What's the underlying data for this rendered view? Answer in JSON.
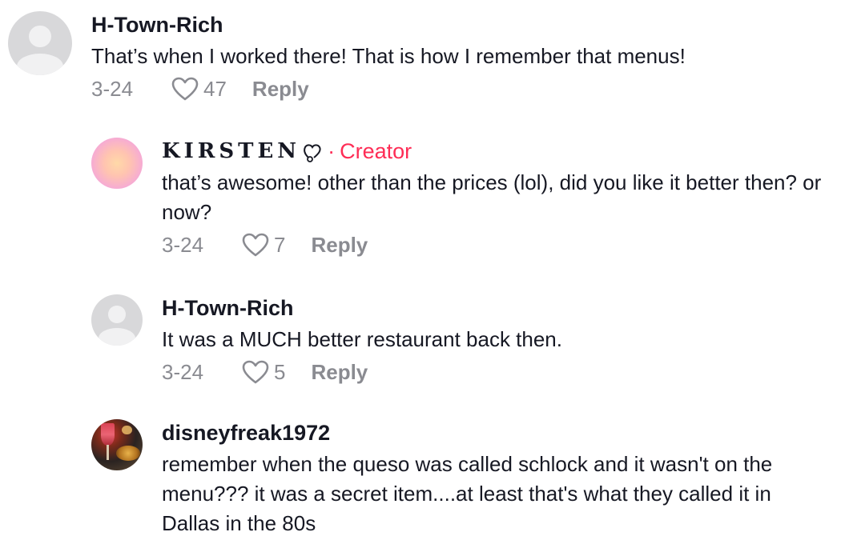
{
  "comments": [
    {
      "username": "H-Town-Rich",
      "text": "That’s when I worked there! That is how I remember that menus!",
      "date": "3-24",
      "likes": "47",
      "reply_label": "Reply"
    },
    {
      "username": "KIRSTEN",
      "creator_label": "Creator",
      "separator": "·",
      "text": "that’s awesome! other than the prices (lol), did you like it better then? or now?",
      "date": "3-24",
      "likes": "7",
      "reply_label": "Reply"
    },
    {
      "username": "H-Town-Rich",
      "text": "It was a MUCH better restaurant back then.",
      "date": "3-24",
      "likes": "5",
      "reply_label": "Reply"
    },
    {
      "username": "disneyfreak1972",
      "text": "remember when the queso was called schlock and it wasn't on the menu??? it was a secret item....at least that's what they called it in Dallas in the 80s"
    }
  ],
  "colors": {
    "text": "#161823",
    "muted": "#8a8b91",
    "creator_accent": "#fe2c55"
  },
  "icons": [
    "heart-outline-icon",
    "creator-heart-icon",
    "default-avatar-icon"
  ]
}
